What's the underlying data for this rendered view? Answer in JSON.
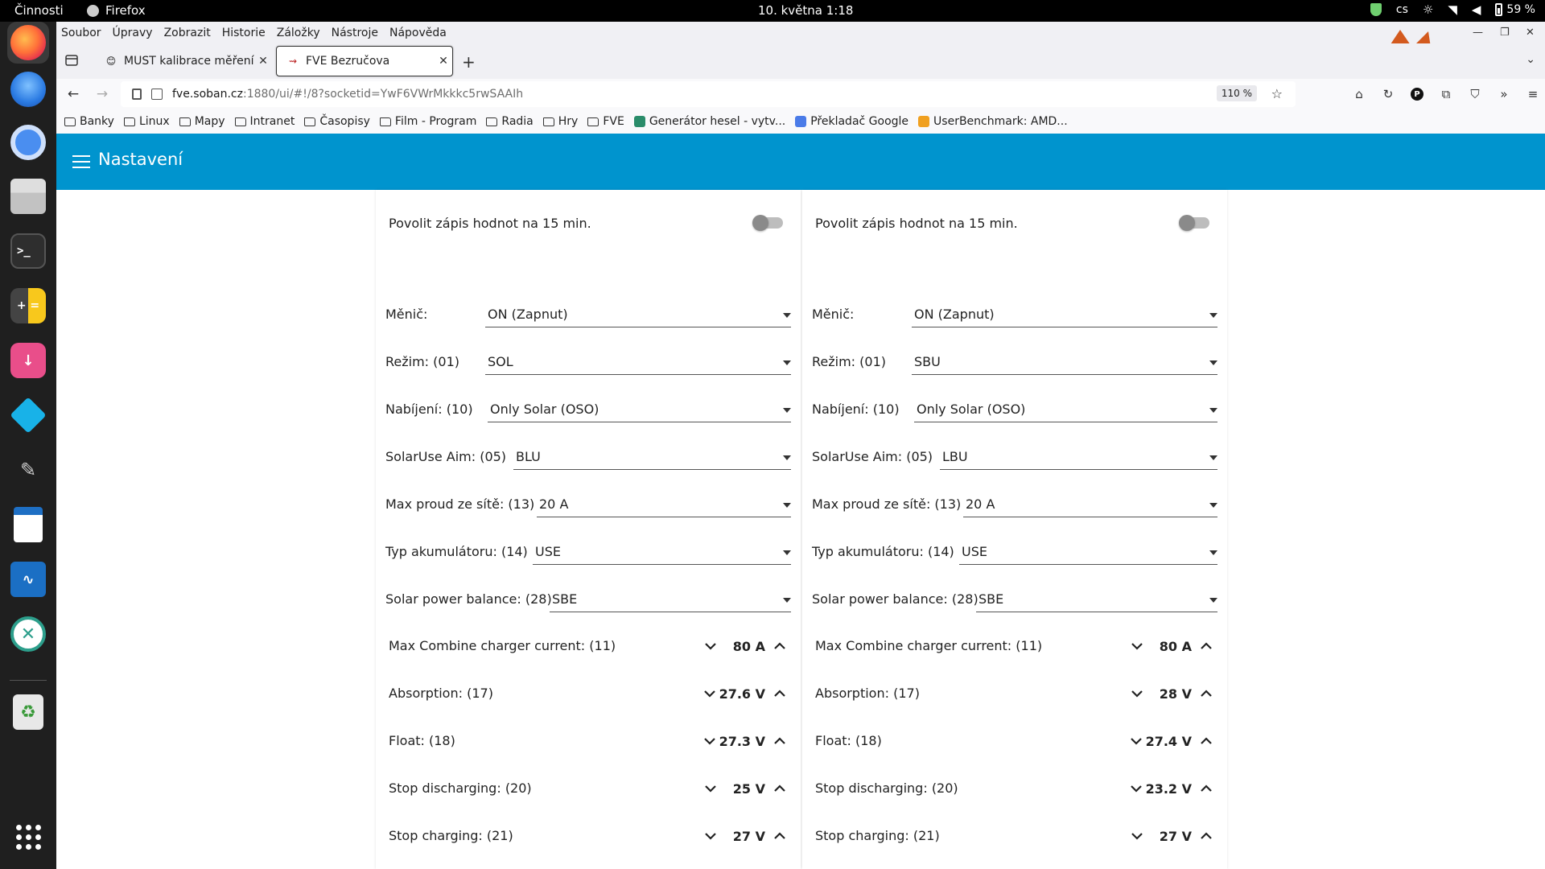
{
  "system": {
    "activities": "Činnosti",
    "app_name": "Firefox",
    "clock": "10. května  1:18",
    "keyboard_layout": "cs",
    "battery": "59 %"
  },
  "menu": [
    "Soubor",
    "Úpravy",
    "Zobrazit",
    "Historie",
    "Záložky",
    "Nástroje",
    "Nápověda"
  ],
  "tabs": [
    {
      "title": "MUST kalibrace měření - ",
      "active": false
    },
    {
      "title": "FVE Bezručova",
      "active": true
    }
  ],
  "url": {
    "host": "fve.soban.cz",
    "rest": ":1880/ui/#!/8?socketid=YwF6VWrMkkkc5rwSAAIh"
  },
  "zoom": "110 %",
  "bookmarks": [
    {
      "label": "Banky",
      "type": "folder"
    },
    {
      "label": "Linux",
      "type": "folder"
    },
    {
      "label": "Mapy",
      "type": "folder"
    },
    {
      "label": "Intranet",
      "type": "folder"
    },
    {
      "label": "Časopisy",
      "type": "folder"
    },
    {
      "label": "Film - Program",
      "type": "folder"
    },
    {
      "label": "Radia",
      "type": "folder"
    },
    {
      "label": "Hry",
      "type": "folder"
    },
    {
      "label": "FVE",
      "type": "folder"
    },
    {
      "label": "Generátor hesel - vytv...",
      "type": "site",
      "color": "#2a8c6a"
    },
    {
      "label": "Překladač Google",
      "type": "site",
      "color": "#4a7be8"
    },
    {
      "label": "UserBenchmark: AMD...",
      "type": "site",
      "color": "#f0a020"
    }
  ],
  "page": {
    "title": "Nastavení",
    "accent_color": "#0094ce",
    "columns": [
      {
        "switch_label": "Povolit zápis hodnot na 15 min.",
        "selects": [
          {
            "label": "Měnič:",
            "value": "ON (Zapnut)"
          },
          {
            "label": "Režim: (01)",
            "value": "SOL"
          },
          {
            "label": "Nabíjení: (10)",
            "value": "Only Solar (OSO)"
          },
          {
            "label": "SolarUse Aim: (05)",
            "value": "BLU"
          },
          {
            "label": "Max proud ze sítě: (13)",
            "value": "20 A"
          },
          {
            "label": "Typ akumulátoru: (14)",
            "value": "USE"
          },
          {
            "label": "Solar power balance: (28)",
            "value": "SBE"
          }
        ],
        "numerics": [
          {
            "label": "Max Combine charger current: (11)",
            "value": "80 A"
          },
          {
            "label": "Absorption: (17)",
            "value": "27.6 V"
          },
          {
            "label": "Float: (18)",
            "value": "27.3 V"
          },
          {
            "label": "Stop discharging: (20)",
            "value": "25 V"
          },
          {
            "label": "Stop charging: (21)",
            "value": "27 V"
          }
        ]
      },
      {
        "switch_label": "Povolit zápis hodnot na 15 min.",
        "selects": [
          {
            "label": "Měnič:",
            "value": "ON (Zapnut)"
          },
          {
            "label": "Režim: (01)",
            "value": "SBU"
          },
          {
            "label": "Nabíjení: (10)",
            "value": "Only Solar (OSO)"
          },
          {
            "label": "SolarUse Aim: (05)",
            "value": "LBU"
          },
          {
            "label": "Max proud ze sítě: (13)",
            "value": "20 A"
          },
          {
            "label": "Typ akumulátoru: (14)",
            "value": "USE"
          },
          {
            "label": "Solar power balance: (28)",
            "value": "SBE"
          }
        ],
        "numerics": [
          {
            "label": "Max Combine charger current: (11)",
            "value": "80 A"
          },
          {
            "label": "Absorption: (17)",
            "value": "28 V"
          },
          {
            "label": "Float: (18)",
            "value": "27.4 V"
          },
          {
            "label": "Stop discharging: (20)",
            "value": "23.2 V"
          },
          {
            "label": "Stop charging: (21)",
            "value": "27 V"
          }
        ]
      }
    ]
  }
}
